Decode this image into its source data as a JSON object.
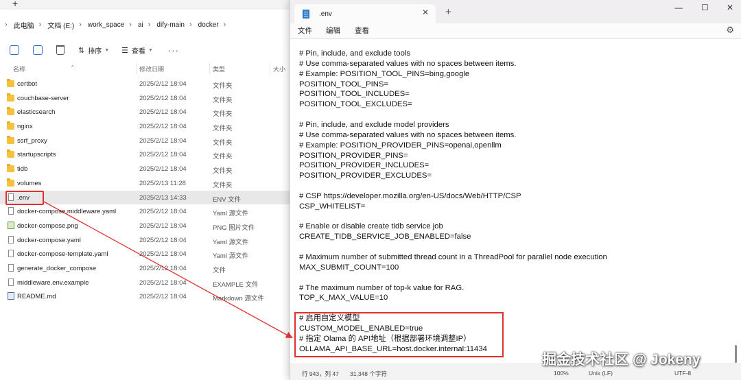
{
  "explorer": {
    "new_tab": "+",
    "breadcrumb": [
      "此电脑",
      "文档 (E:)",
      "work_space",
      "ai",
      "dify-main",
      "docker"
    ],
    "toolbar": {
      "sort_label": "排序",
      "view_label": "查看",
      "more_label": "···"
    },
    "columns": {
      "name": "名称",
      "date": "修改日期",
      "type": "类型",
      "size": "大小"
    },
    "files": [
      {
        "name": "certbot",
        "date": "2025/2/12 18:04",
        "type": "文件夹",
        "icon": "folder-icon"
      },
      {
        "name": "couchbase-server",
        "date": "2025/2/12 18:04",
        "type": "文件夹",
        "icon": "folder-icon"
      },
      {
        "name": "elasticsearch",
        "date": "2025/2/12 18:04",
        "type": "文件夹",
        "icon": "folder-icon"
      },
      {
        "name": "nginx",
        "date": "2025/2/12 18:04",
        "type": "文件夹",
        "icon": "folder-icon"
      },
      {
        "name": "ssrf_proxy",
        "date": "2025/2/12 18:04",
        "type": "文件夹",
        "icon": "folder-icon"
      },
      {
        "name": "startupscripts",
        "date": "2025/2/12 18:04",
        "type": "文件夹",
        "icon": "folder-icon"
      },
      {
        "name": "tidb",
        "date": "2025/2/12 18:04",
        "type": "文件夹",
        "icon": "folder-icon"
      },
      {
        "name": "volumes",
        "date": "2025/2/13 11:28",
        "type": "文件夹",
        "icon": "folder-icon"
      },
      {
        "name": ".env",
        "date": "2025/2/13 14:33",
        "type": "ENV 文件",
        "icon": "file-icon",
        "selected": true
      },
      {
        "name": "docker-compose.middleware.yaml",
        "date": "2025/2/12 18:04",
        "type": "Yaml 源文件",
        "icon": "file-icon"
      },
      {
        "name": "docker-compose.png",
        "date": "2025/2/12 18:04",
        "type": "PNG 图片文件",
        "icon": "image-icon"
      },
      {
        "name": "docker-compose.yaml",
        "date": "2025/2/12 18:04",
        "type": "Yaml 源文件",
        "icon": "file-icon"
      },
      {
        "name": "docker-compose-template.yaml",
        "date": "2025/2/12 18:04",
        "type": "Yaml 源文件",
        "icon": "file-icon"
      },
      {
        "name": "generate_docker_compose",
        "date": "2025/2/12 18:04",
        "type": "文件",
        "icon": "file-icon"
      },
      {
        "name": "middleware.env.example",
        "date": "2025/2/12 18:04",
        "type": "EXAMPLE 文件",
        "icon": "file-icon"
      },
      {
        "name": "README.md",
        "date": "2025/2/12 18:04",
        "type": "Markdown 源文件",
        "icon": "markdown-icon"
      }
    ]
  },
  "notepad": {
    "tab_title": ".env",
    "tab_close": "✕",
    "new_tab": "+",
    "window_controls": {
      "minimize": "—",
      "maximize": "☐",
      "close": "✕"
    },
    "menu": {
      "file": "文件",
      "edit": "编辑",
      "view": "查看"
    },
    "lines": [
      "# Pin, include, and exclude tools",
      "# Use comma-separated values with no spaces between items.",
      "# Example: POSITION_TOOL_PINS=bing,google",
      "POSITION_TOOL_PINS=",
      "POSITION_TOOL_INCLUDES=",
      "POSITION_TOOL_EXCLUDES=",
      "",
      "# Pin, include, and exclude model providers",
      "# Use comma-separated values with no spaces between items.",
      "# Example: POSITION_PROVIDER_PINS=openai,openllm",
      "POSITION_PROVIDER_PINS=",
      "POSITION_PROVIDER_INCLUDES=",
      "POSITION_PROVIDER_EXCLUDES=",
      "",
      "# CSP https://developer.mozilla.org/en-US/docs/Web/HTTP/CSP",
      "CSP_WHITELIST=",
      "",
      "# Enable or disable create tidb service job",
      "CREATE_TIDB_SERVICE_JOB_ENABLED=false",
      "",
      "# Maximum number of submitted thread count in a ThreadPool for parallel node execution",
      "MAX_SUBMIT_COUNT=100",
      "",
      "# The maximum number of top-k value for RAG.",
      "TOP_K_MAX_VALUE=10",
      "",
      "# 启用自定义模型",
      "CUSTOM_MODEL_ENABLED=true",
      "# 指定 Olama 的 API地址（根据部署环境调整IP）",
      "OLLAMA_API_BASE_URL=host.docker.internal:11434"
    ],
    "status": {
      "position": "行 943，列 47",
      "chars": "31,348 个字符",
      "zoom": "100%",
      "line_ending": "Unix (LF)",
      "encoding": "UTF-8"
    }
  },
  "watermark": "掘金技术社区 @ Jokeny",
  "highlight_color": "#e03030"
}
